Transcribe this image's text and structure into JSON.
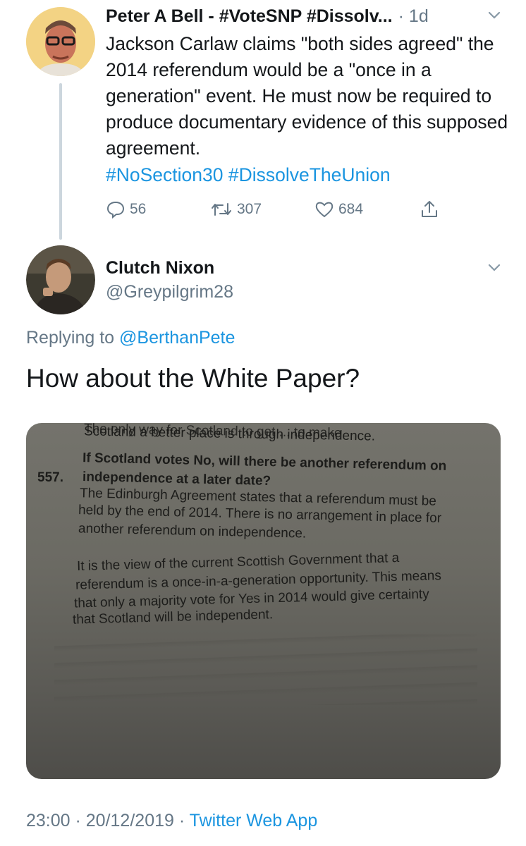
{
  "parent_tweet": {
    "display_name": "Peter A Bell - #VoteSNP #Dissolv...",
    "time_ago": "· 1d",
    "text": "Jackson Carlaw claims \"both sides agreed\" the 2014 referendum would be a \"once in a generation\" event. He must now be required to produce documentary evidence of this supposed agreement.",
    "hashtags": "#NoSection30 #DissolveTheUnion",
    "replies_count": "56",
    "retweets_count": "307",
    "likes_count": "684",
    "icons": [
      "reply-icon",
      "retweet-icon",
      "like-icon",
      "share-icon",
      "chevron-down-icon"
    ]
  },
  "reply_tweet": {
    "display_name": "Clutch Nixon",
    "handle": "@Greypilgrim28",
    "replying_prefix": "Replying to",
    "replying_to": "@BerthanPete",
    "text": "How about the White Paper?",
    "image_text": {
      "line1": "The only way for Scotland to get ... to make",
      "line2": "Scotland a better place is through independence.",
      "number": "557.",
      "question1": "If Scotland votes No, will there be another referendum on",
      "question2": "independence at a later date?",
      "p1_1": "The Edinburgh Agreement states that a referendum must be",
      "p1_2": "held by the end of 2014. There is no arrangement in place for",
      "p1_3": "another referendum on independence.",
      "p2_1": "It is the view of the current Scottish Government that a",
      "p2_2": "referendum is a once-in-a-generation opportunity. This means",
      "p2_3": "that only a majority vote for Yes in 2014 would give certainty",
      "p2_4": "that Scotland will be independent."
    },
    "timestamp": "23:00 · 20/12/2019 ·",
    "source": "Twitter Web App"
  },
  "colors": {
    "link": "#1b95e0",
    "secondary": "#657786",
    "thread_line": "#ccd6dd"
  }
}
